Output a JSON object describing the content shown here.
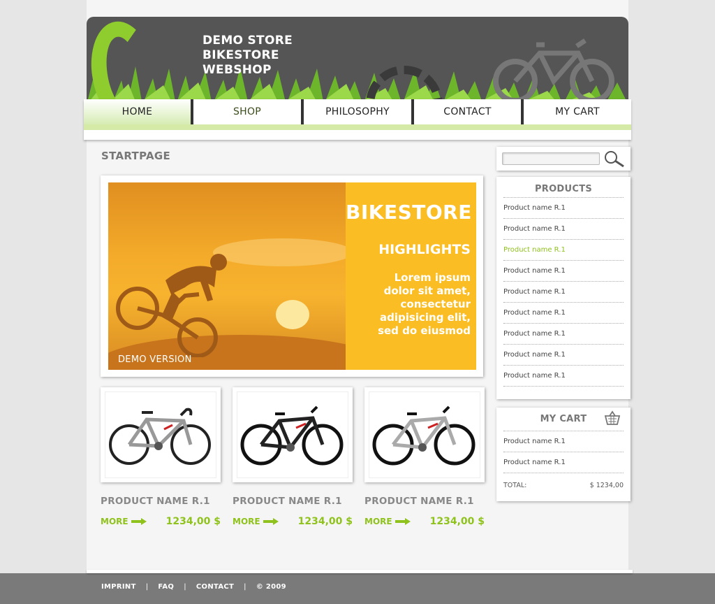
{
  "header": {
    "logo_line1": "DEMO STORE",
    "logo_line2": "BIKESTORE",
    "logo_line3": "WEBSHOP"
  },
  "nav": {
    "items": [
      {
        "label": "HOME"
      },
      {
        "label": "SHOP"
      },
      {
        "label": "PHILOSOPHY"
      },
      {
        "label": "CONTACT"
      },
      {
        "label": "MY CART"
      }
    ]
  },
  "main": {
    "page_title": "STARTPAGE",
    "banner": {
      "title": "BIKESTORE",
      "subtitle": "HIGHLIGHTS",
      "text_lines": [
        "Lorem ipsum",
        "dolor sit amet,",
        "consectetur",
        "adipisicing elit,",
        "sed do eiusmod"
      ],
      "demo_label": "DEMO VERSION"
    },
    "products": [
      {
        "name": "PRODUCT NAME R.1",
        "more": "MORE",
        "price": "1234,00 $"
      },
      {
        "name": "PRODUCT NAME R.1",
        "more": "MORE",
        "price": "1234,00 $"
      },
      {
        "name": "PRODUCT NAME R.1",
        "more": "MORE",
        "price": "1234,00 $"
      }
    ]
  },
  "sidebar": {
    "products": {
      "title": "PRODUCTS",
      "items": [
        {
          "label": "Product name R.1"
        },
        {
          "label": "Product name R.1"
        },
        {
          "label": "Product name R.1"
        },
        {
          "label": "Product name R.1"
        },
        {
          "label": "Product name R.1"
        },
        {
          "label": "Product name R.1"
        },
        {
          "label": "Product name R.1"
        },
        {
          "label": "Product name R.1"
        },
        {
          "label": "Product name R.1"
        }
      ]
    },
    "cart": {
      "title": "MY CART",
      "items": [
        {
          "label": "Product name R.1"
        },
        {
          "label": "Product name R.1"
        }
      ],
      "total_label": "TOTAL:",
      "total_value": "$ 1234,00"
    }
  },
  "footer": {
    "links": [
      {
        "label": "IMPRINT"
      },
      {
        "label": "FAQ"
      },
      {
        "label": "CONTACT"
      },
      {
        "label": "© 2009"
      }
    ],
    "separator": "|"
  },
  "colors": {
    "accent_green": "#8fc21c",
    "banner_yellow": "#fbbd24",
    "header_dark": "#555555"
  }
}
